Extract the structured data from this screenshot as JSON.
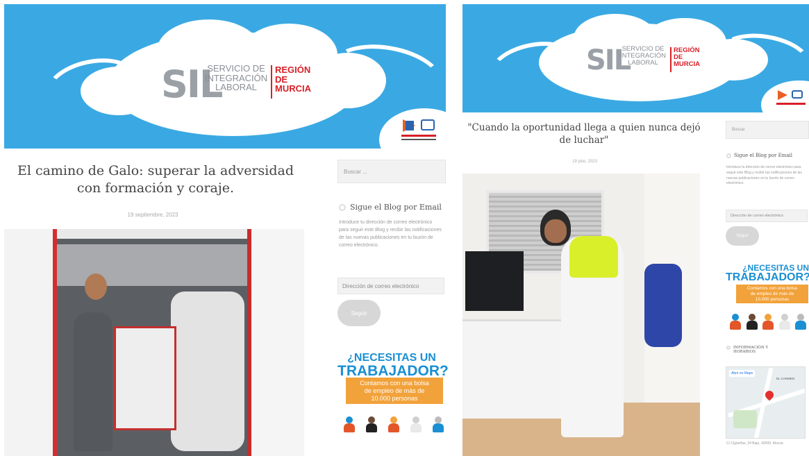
{
  "logo": {
    "sil": "SIL",
    "sub_line1": "SERVICIO DE",
    "sub_line2": "INTEGRACIÓN",
    "sub_line3": "LABORAL",
    "region_line1": "REGIÓN",
    "region_line2": "DE",
    "region_line3": "MURCIA"
  },
  "left": {
    "post_title": "El camino de Galo: superar la adversidad con formación y coraje.",
    "post_date": "19 septiembre, 2023",
    "search_placeholder": "Buscar ...",
    "follow_title": "Sigue el Blog por Email",
    "follow_text": "Introduce tu dirección de correo electrónico para seguir este Blog y recibir las notificaciones de las nuevas publicaciones en tu buzón de correo electrónico.",
    "email_placeholder": "Dirección de correo electrónico",
    "follow_button": "Seguir",
    "ad_line1": "¿NECESITAS UN",
    "ad_line2": "TRABAJADOR?",
    "ad_strip_line1": "Contamos con una bolsa",
    "ad_strip_line2": "de empleo de más de",
    "ad_strip_line3": "10.000 personas"
  },
  "right": {
    "post_title": "\"Cuando la oportunidad llega a quien nunca dejó de luchar\"",
    "post_date": "19 julio, 2023",
    "search_placeholder": "Buscar",
    "follow_title": "Sigue el Blog por Email",
    "follow_text": "Introduce tu dirección de correo electrónico para seguir este Blog y recibir las notificaciones de las nuevas publicaciones en tu buzón de correo electrónico.",
    "email_placeholder": "Dirección de correo electrónico",
    "follow_button": "Seguir",
    "ad_line1": "¿NECESITAS UN",
    "ad_line2": "TRABAJADOR?",
    "ad_strip_line1": "Contamos con una bolsa",
    "ad_strip_line2": "de empleo de más de",
    "ad_strip_line3": "10.000 personas",
    "info_title": "INFORMACIÓN Y HORARIOS",
    "map_link": "Abrir en Maps",
    "map_label": "EL CARMEN",
    "address": "C/ Cigüeñas, 24 Bajo, 30009, Murcia"
  },
  "colors": {
    "sky": "#3aa9e3",
    "region_red": "#d81f26",
    "ad_blue": "#1a8fd3",
    "ad_orange": "#f2a23a"
  }
}
